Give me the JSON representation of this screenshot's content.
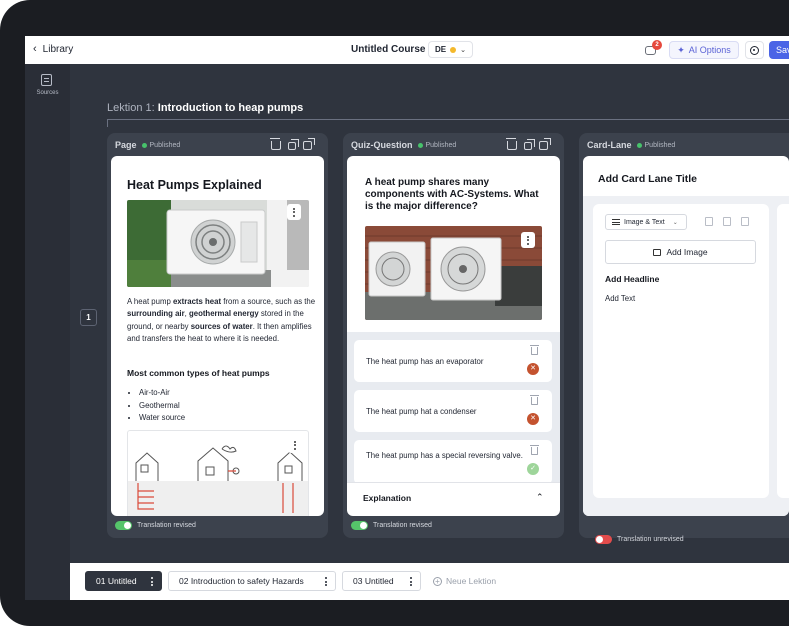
{
  "topbar": {
    "back_label": "Library",
    "course_title": "Untitled Course",
    "language_code": "DE",
    "comments_count": "2",
    "ai_options_label": "AI Options",
    "save_label": "Save"
  },
  "rail": {
    "sources_label": "Sources"
  },
  "lesson": {
    "prefix": "Lektion 1:",
    "title": "Introduction to heap pumps",
    "number": "1"
  },
  "columns": {
    "page": {
      "label": "Page",
      "status": "Published",
      "title": "Heat Pumps Explained",
      "paragraph_segments": [
        {
          "t": "A heat pump ",
          "b": false
        },
        {
          "t": "extracts heat",
          "b": true
        },
        {
          "t": " from a source, such as the ",
          "b": false
        },
        {
          "t": "surrounding air",
          "b": true
        },
        {
          "t": ", ",
          "b": false
        },
        {
          "t": "geothermal energy",
          "b": true
        },
        {
          "t": " stored in the ground, or nearby ",
          "b": false
        },
        {
          "t": "sources of water",
          "b": true
        },
        {
          "t": ". It then amplifies and transfers the heat to where it is needed.",
          "b": false
        }
      ],
      "subheading": "Most common types of heat pumps",
      "types": [
        "Air-to-Air",
        "Geothermal",
        "Water source"
      ],
      "translation_label": "Translation revised"
    },
    "quiz": {
      "label": "Quiz-Question",
      "status": "Published",
      "question": "A heat pump shares many components with AC-Systems. What is the major difference?",
      "answers": [
        {
          "text": "The heat pump has an evaporator",
          "correct": false
        },
        {
          "text": "The heat pump hat a condenser",
          "correct": false
        },
        {
          "text": "The heat pump has a special reversing valve.",
          "correct": true
        }
      ],
      "explanation_label": "Explanation",
      "translation_label": "Translation revised"
    },
    "lane": {
      "label": "Card-Lane",
      "status": "Published",
      "title": "Add Card Lane Title",
      "type_select": "Image & Text",
      "add_image": "Add Image",
      "add_headline": "Add Headline",
      "add_text": "Add Text",
      "translation_label": "Translation unrevised"
    }
  },
  "bottom_tabs": [
    {
      "label": "01 Untitled",
      "active": true
    },
    {
      "label": "02 Introduction to safety Hazards",
      "active": false
    },
    {
      "label": "03 Untitled",
      "active": false
    }
  ],
  "new_lesson_label": "Neue Lektion",
  "colors": {
    "accent": "#4a64e6",
    "published": "#47c26b",
    "wrong": "#c4532f",
    "right": "#9ed59a",
    "unrevised": "#e34c4c"
  }
}
